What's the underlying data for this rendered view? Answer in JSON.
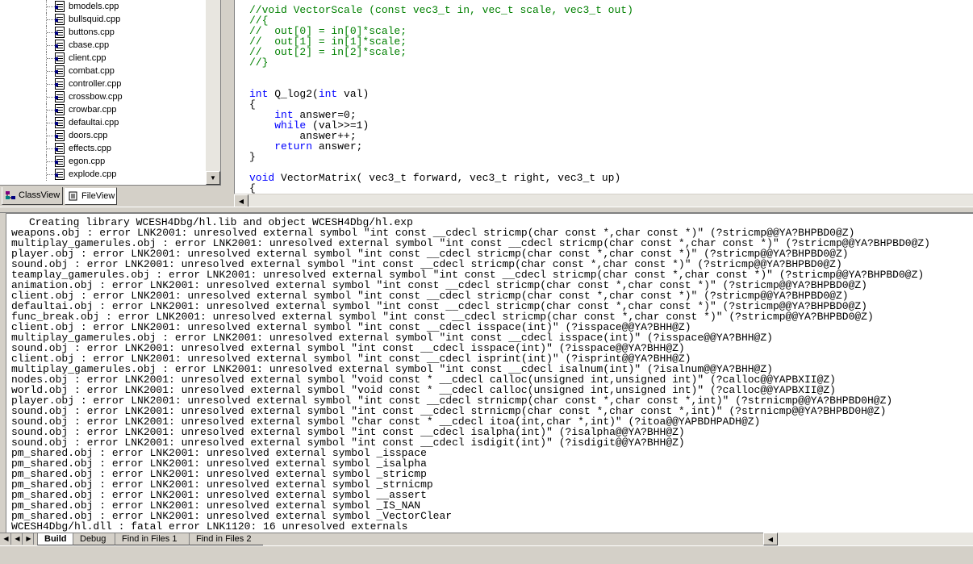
{
  "file_tree": {
    "files": [
      "bmodels.cpp",
      "bullsquid.cpp",
      "buttons.cpp",
      "cbase.cpp",
      "client.cpp",
      "combat.cpp",
      "controller.cpp",
      "crossbow.cpp",
      "crowbar.cpp",
      "defaultai.cpp",
      "doors.cpp",
      "effects.cpp",
      "egon.cpp",
      "explode.cpp"
    ],
    "tabs": [
      {
        "label": "ClassView",
        "icon": "classview-icon"
      },
      {
        "label": "FileView",
        "icon": "fileview-icon"
      }
    ]
  },
  "editor": {
    "lines": [
      {
        "parts": [
          {
            "t": "//void VectorScale (const vec3_t in, vec_t scale, vec3_t out)",
            "c": "cmt"
          }
        ]
      },
      {
        "parts": [
          {
            "t": "//{",
            "c": "cmt"
          }
        ]
      },
      {
        "parts": [
          {
            "t": "//  out[0] = in[0]*scale;",
            "c": "cmt"
          }
        ]
      },
      {
        "parts": [
          {
            "t": "//  out[1] = in[1]*scale;",
            "c": "cmt"
          }
        ]
      },
      {
        "parts": [
          {
            "t": "//  out[2] = in[2]*scale;",
            "c": "cmt"
          }
        ]
      },
      {
        "parts": [
          {
            "t": "//}",
            "c": "cmt"
          }
        ]
      },
      {
        "parts": []
      },
      {
        "parts": []
      },
      {
        "parts": [
          {
            "t": "int",
            "c": "kw"
          },
          {
            "t": " Q_log2(",
            "c": ""
          },
          {
            "t": "int",
            "c": "kw"
          },
          {
            "t": " val)",
            "c": ""
          }
        ]
      },
      {
        "parts": [
          {
            "t": "{",
            "c": ""
          }
        ]
      },
      {
        "parts": [
          {
            "t": "    ",
            "c": ""
          },
          {
            "t": "int",
            "c": "kw"
          },
          {
            "t": " answer=0;",
            "c": ""
          }
        ]
      },
      {
        "parts": [
          {
            "t": "    ",
            "c": ""
          },
          {
            "t": "while",
            "c": "kw"
          },
          {
            "t": " (val>>=1)",
            "c": ""
          }
        ]
      },
      {
        "parts": [
          {
            "t": "        answer++;",
            "c": ""
          }
        ]
      },
      {
        "parts": [
          {
            "t": "    ",
            "c": ""
          },
          {
            "t": "return",
            "c": "kw"
          },
          {
            "t": " answer;",
            "c": ""
          }
        ]
      },
      {
        "parts": [
          {
            "t": "}",
            "c": ""
          }
        ]
      },
      {
        "parts": []
      },
      {
        "parts": [
          {
            "t": "void",
            "c": "kw"
          },
          {
            "t": " VectorMatrix( vec3_t forward, vec3_t right, vec3_t up)",
            "c": ""
          }
        ]
      },
      {
        "parts": [
          {
            "t": "{",
            "c": ""
          }
        ]
      }
    ]
  },
  "output": {
    "lines": [
      {
        "text": "Creating library WCESH4Dbg/hl.lib and object WCESH4Dbg/hl.exp",
        "indent": true
      },
      {
        "text": "weapons.obj : error LNK2001: unresolved external symbol \"int const __cdecl stricmp(char const *,char const *)\" (?stricmp@@YA?BHPBD0@Z)"
      },
      {
        "text": "multiplay_gamerules.obj : error LNK2001: unresolved external symbol \"int const __cdecl stricmp(char const *,char const *)\" (?stricmp@@YA?BHPBD0@Z)"
      },
      {
        "text": "player.obj : error LNK2001: unresolved external symbol \"int const __cdecl stricmp(char const *,char const *)\" (?stricmp@@YA?BHPBD0@Z)"
      },
      {
        "text": "sound.obj : error LNK2001: unresolved external symbol \"int const __cdecl stricmp(char const *,char const *)\" (?stricmp@@YA?BHPBD0@Z)"
      },
      {
        "text": "teamplay_gamerules.obj : error LNK2001: unresolved external symbol \"int const __cdecl stricmp(char const *,char const *)\" (?stricmp@@YA?BHPBD0@Z)"
      },
      {
        "text": "animation.obj : error LNK2001: unresolved external symbol \"int const __cdecl stricmp(char const *,char const *)\" (?stricmp@@YA?BHPBD0@Z)"
      },
      {
        "text": "client.obj : error LNK2001: unresolved external symbol \"int const __cdecl stricmp(char const *,char const *)\" (?stricmp@@YA?BHPBD0@Z)"
      },
      {
        "text": "defaultai.obj : error LNK2001: unresolved external symbol \"int const __cdecl stricmp(char const *,char const *)\" (?stricmp@@YA?BHPBD0@Z)"
      },
      {
        "text": "func_break.obj : error LNK2001: unresolved external symbol \"int const __cdecl stricmp(char const *,char const *)\" (?stricmp@@YA?BHPBD0@Z)"
      },
      {
        "text": "client.obj : error LNK2001: unresolved external symbol \"int const __cdecl isspace(int)\" (?isspace@@YA?BHH@Z)"
      },
      {
        "text": "multiplay_gamerules.obj : error LNK2001: unresolved external symbol \"int const __cdecl isspace(int)\" (?isspace@@YA?BHH@Z)"
      },
      {
        "text": "sound.obj : error LNK2001: unresolved external symbol \"int const __cdecl isspace(int)\" (?isspace@@YA?BHH@Z)"
      },
      {
        "text": "client.obj : error LNK2001: unresolved external symbol \"int const __cdecl isprint(int)\" (?isprint@@YA?BHH@Z)"
      },
      {
        "text": "multiplay_gamerules.obj : error LNK2001: unresolved external symbol \"int const __cdecl isalnum(int)\" (?isalnum@@YA?BHH@Z)"
      },
      {
        "text": "nodes.obj : error LNK2001: unresolved external symbol \"void const * __cdecl calloc(unsigned int,unsigned int)\" (?calloc@@YAPBXII@Z)"
      },
      {
        "text": "world.obj : error LNK2001: unresolved external symbol \"void const * __cdecl calloc(unsigned int,unsigned int)\" (?calloc@@YAPBXII@Z)"
      },
      {
        "text": "player.obj : error LNK2001: unresolved external symbol \"int const __cdecl strnicmp(char const *,char const *,int)\" (?strnicmp@@YA?BHPBD0H@Z)"
      },
      {
        "text": "sound.obj : error LNK2001: unresolved external symbol \"int const __cdecl strnicmp(char const *,char const *,int)\" (?strnicmp@@YA?BHPBD0H@Z)"
      },
      {
        "text": "sound.obj : error LNK2001: unresolved external symbol \"char const * __cdecl itoa(int,char *,int)\" (?itoa@@YAPBDHPADH@Z)"
      },
      {
        "text": "sound.obj : error LNK2001: unresolved external symbol \"int const __cdecl isalpha(int)\" (?isalpha@@YA?BHH@Z)"
      },
      {
        "text": "sound.obj : error LNK2001: unresolved external symbol \"int const __cdecl isdigit(int)\" (?isdigit@@YA?BHH@Z)"
      },
      {
        "text": "pm_shared.obj : error LNK2001: unresolved external symbol _isspace"
      },
      {
        "text": "pm_shared.obj : error LNK2001: unresolved external symbol _isalpha"
      },
      {
        "text": "pm_shared.obj : error LNK2001: unresolved external symbol _stricmp"
      },
      {
        "text": "pm_shared.obj : error LNK2001: unresolved external symbol _strnicmp"
      },
      {
        "text": "pm_shared.obj : error LNK2001: unresolved external symbol __assert"
      },
      {
        "text": "pm_shared.obj : error LNK2001: unresolved external symbol _IS_NAN"
      },
      {
        "text": "pm_shared.obj : error LNK2001: unresolved external symbol _VectorClear"
      },
      {
        "text": "WCESH4Dbg/hl.dll : fatal error LNK1120: 16 unresolved externals"
      }
    ],
    "tabs": [
      {
        "label": "Build",
        "active": true
      },
      {
        "label": "Debug",
        "active": false
      },
      {
        "label": "Find in Files 1",
        "active": false
      },
      {
        "label": "Find in Files 2",
        "active": false
      }
    ]
  },
  "icons": {
    "scroll_up": "▲",
    "scroll_down": "▼",
    "scroll_left": "◀",
    "scroll_right": "▶"
  }
}
